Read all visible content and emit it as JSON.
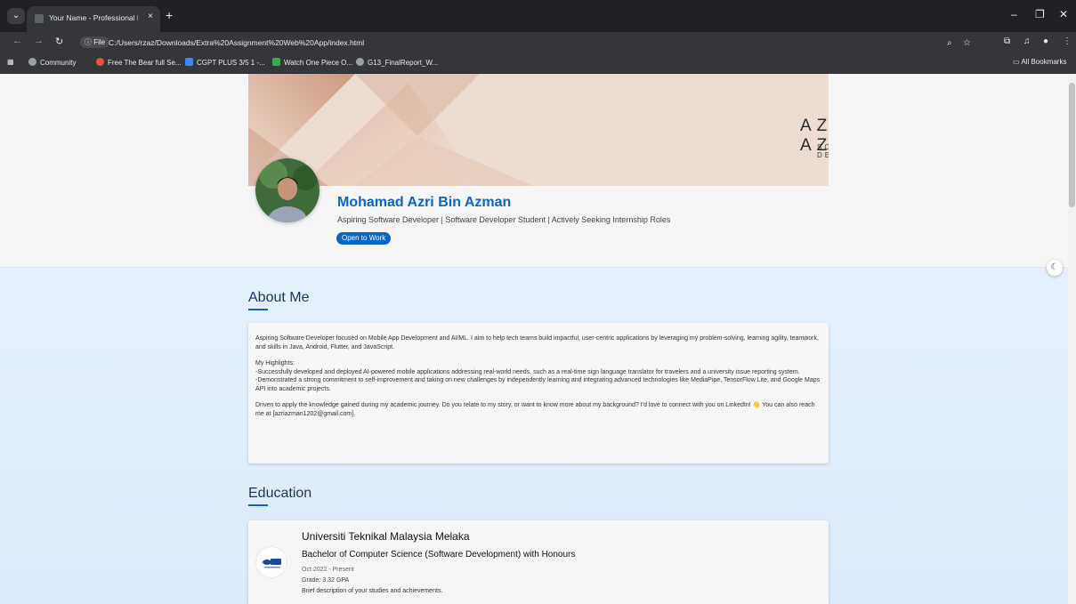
{
  "browser": {
    "tab_title": "Your Name - Professional Portfo",
    "tab_close": "×",
    "new_tab": "+",
    "file_chip": "ⓘ File",
    "url": "C:/Users/rzaz/Downloads/Extra%20Assignment%20Web%20App/index.html",
    "bookmarks": [
      {
        "label": "Community",
        "color": "#9aa0a6"
      },
      {
        "label": "Free The Bear full Se...",
        "color": "#e8553e"
      },
      {
        "label": "CGPT PLUS 3/5 1 -...",
        "color": "#4285f4"
      },
      {
        "label": "Watch One Piece O...",
        "color": "#34a853"
      },
      {
        "label": "G13_FinalReport_W...",
        "color": "#9aa0a6"
      }
    ],
    "all_bookmarks": "All Bookmarks"
  },
  "banner": {
    "name": "AZRI AZMAN",
    "role": "SOFTWARE DEVELOPER"
  },
  "profile": {
    "name": "Mohamad Azri Bin Azman",
    "headline": "Aspiring Software Developer | Software Developer Student | Actively Seeking Internship Roles",
    "open_to_work": "Open to Work"
  },
  "about": {
    "title": "About Me",
    "intro": "Aspiring Software Developer focused on Mobile App Development and AI/ML. I aim to help tech teams build impactful, user-centric applications by leveraging my problem-solving, learning agility, teamwork, and skills in Java, Android, Flutter, and JavaScript.",
    "highlights_heading": "My Highlights:",
    "highlight_1": "-Successfully developed and deployed AI-powered mobile applications addressing real-world needs, such as a real-time sign language translator for travelers and a university issue reporting system.",
    "highlight_2": "-Demonstrated a strong commitment to self-improvement and taking on new challenges by independently learning and integrating advanced technologies like MediaPipe, TensorFlow Lite, and Google Maps API into academic projects.",
    "closing": "Driven to apply the knowledge gained during my academic journey. Do you relate to my story, or want to know more about my background? I'd love to connect with you on LinkedIn! 👋 You can also reach me at [azriazman1202@gmail.com]."
  },
  "education": {
    "title": "Education",
    "entries": [
      {
        "school": "Universiti Teknikal Malaysia Melaka",
        "degree": "Bachelor of Computer Science (Software Development) with Honours",
        "dates": "Oct 2022 - Present",
        "grade": "Grade: 3.32 GPA",
        "description": "Brief description of your studies and achievements."
      }
    ]
  },
  "theme_toggle": "☾",
  "colors": {
    "accent": "#0a66c2",
    "banner": "#ead8cb"
  }
}
